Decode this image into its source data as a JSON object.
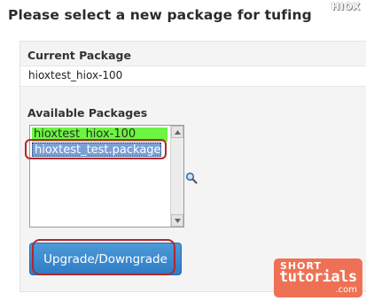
{
  "header": {
    "title": "Please select a new package for tufing",
    "logo_text": "HIOX"
  },
  "current_package": {
    "label": "Current Package",
    "value": "hioxtest_hiox-100"
  },
  "available_packages": {
    "label": "Available Packages",
    "options": [
      {
        "label": "hioxtest_hiox-100",
        "color": "#6cf542"
      },
      {
        "label": "hioxtest_test.package",
        "selected": true,
        "color": "#7aa0d6"
      }
    ]
  },
  "search_icon": "magnifier-icon",
  "upgrade_button": {
    "label": "Upgrade/Downgrade",
    "color": "#3a8bd0"
  },
  "annotation_color": "#b3262c",
  "branding": {
    "line1": "SHORT",
    "line2": "tutorials",
    "line3": ".com",
    "color": "#ef7155"
  }
}
